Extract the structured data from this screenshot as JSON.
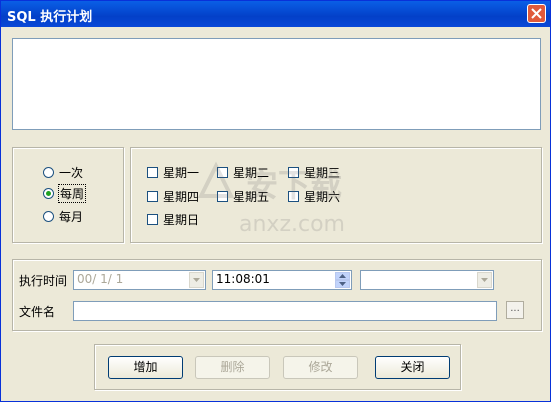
{
  "window": {
    "title": "SQL 执行计划"
  },
  "frequency": {
    "options": [
      {
        "label": "一次",
        "checked": false
      },
      {
        "label": "每周",
        "checked": true
      },
      {
        "label": "每月",
        "checked": false
      }
    ]
  },
  "weekdays": [
    "星期一",
    "星期二",
    "星期三",
    "星期四",
    "星期五",
    "星期六",
    "星期日"
  ],
  "schedule": {
    "time_label": "执行时间",
    "date_value": "00/ 1/ 1",
    "time_value": "11:08:01",
    "extra_value": "",
    "file_label": "文件名",
    "file_value": "",
    "browse_label": "..."
  },
  "buttons": {
    "add": "增加",
    "delete": "删除",
    "modify": "修改",
    "close": "关闭"
  },
  "watermark": {
    "text": "安下载",
    "url": "anxz.com"
  },
  "colors": {
    "title_bar": "#0a5fe6",
    "window_bg": "#ece9d8",
    "close_button": "#e05a3b"
  }
}
